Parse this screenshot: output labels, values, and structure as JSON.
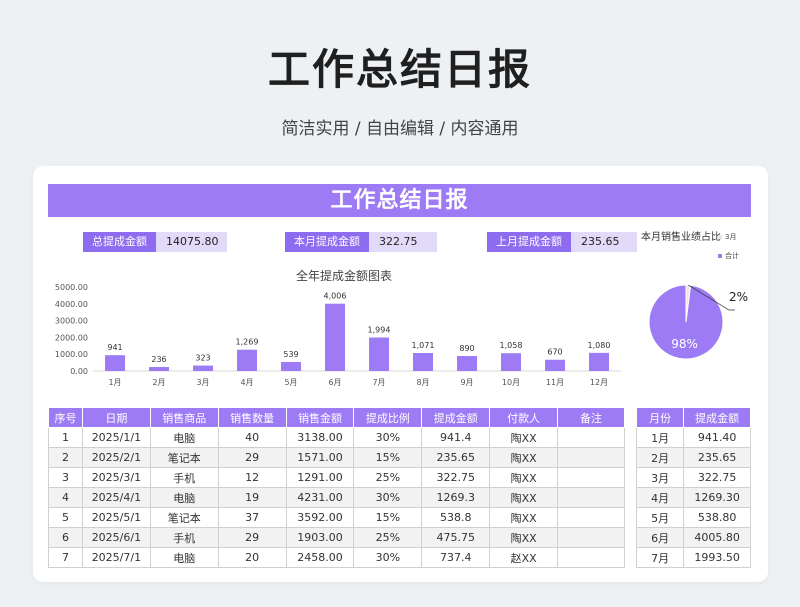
{
  "header": {
    "title": "工作总结日报",
    "subtitle": "简洁实用 / 自由编辑 / 内容通用"
  },
  "banner": {
    "title": "工作总结日报"
  },
  "kpis": [
    {
      "label": "总提成金额",
      "value": "14075.80"
    },
    {
      "label": "本月提成金额",
      "value": "322.75"
    },
    {
      "label": "上月提成金额",
      "value": "235.65"
    }
  ],
  "chart_data": [
    {
      "type": "bar",
      "title": "全年提成金额图表",
      "categories": [
        "1月",
        "2月",
        "3月",
        "4月",
        "5月",
        "6月",
        "7月",
        "8月",
        "9月",
        "10月",
        "11月",
        "12月"
      ],
      "values": [
        941,
        236,
        323,
        1269,
        539,
        4006,
        1994,
        1071,
        890,
        1058,
        670,
        1080
      ],
      "data_labels": [
        "941",
        "236",
        "323",
        "1,269",
        "539",
        "4,006",
        "1,994",
        "1,071",
        "890",
        "1,058",
        "670",
        "1,080"
      ],
      "y_ticks": [
        "0.00",
        "1000.00",
        "2000.00",
        "3000.00",
        "4000.00",
        "5000.00"
      ],
      "ylim": [
        0,
        5000
      ],
      "color": "#9c7bf5"
    },
    {
      "type": "pie",
      "title": "本月销售业绩占比",
      "labels": [
        "3月",
        "合计"
      ],
      "values": [
        2,
        98
      ],
      "value_labels": [
        "2%",
        "98%"
      ],
      "colors": [
        "#f0e0e8",
        "#9c7bf5"
      ],
      "legend": "right"
    }
  ],
  "table": {
    "headers": [
      "序号",
      "日期",
      "销售商品",
      "销售数量",
      "销售金额",
      "提成比例",
      "提成金额",
      "付款人",
      "备注"
    ],
    "rows": [
      [
        "1",
        "2025/1/1",
        "电脑",
        "40",
        "3138.00",
        "30%",
        "941.4",
        "陶XX",
        ""
      ],
      [
        "2",
        "2025/2/1",
        "笔记本",
        "29",
        "1571.00",
        "15%",
        "235.65",
        "陶XX",
        ""
      ],
      [
        "3",
        "2025/3/1",
        "手机",
        "12",
        "1291.00",
        "25%",
        "322.75",
        "陶XX",
        ""
      ],
      [
        "4",
        "2025/4/1",
        "电脑",
        "19",
        "4231.00",
        "30%",
        "1269.3",
        "陶XX",
        ""
      ],
      [
        "5",
        "2025/5/1",
        "笔记本",
        "37",
        "3592.00",
        "15%",
        "538.8",
        "陶XX",
        ""
      ],
      [
        "6",
        "2025/6/1",
        "手机",
        "29",
        "1903.00",
        "25%",
        "475.75",
        "陶XX",
        ""
      ],
      [
        "7",
        "2025/7/1",
        "电脑",
        "20",
        "2458.00",
        "30%",
        "737.4",
        "赵XX",
        ""
      ]
    ]
  },
  "side_table": {
    "headers": [
      "月份",
      "提成金额"
    ],
    "rows": [
      [
        "1月",
        "941.40"
      ],
      [
        "2月",
        "235.65"
      ],
      [
        "3月",
        "322.75"
      ],
      [
        "4月",
        "1269.30"
      ],
      [
        "5月",
        "538.80"
      ],
      [
        "6月",
        "4005.80"
      ],
      [
        "7月",
        "1993.50"
      ]
    ]
  }
}
